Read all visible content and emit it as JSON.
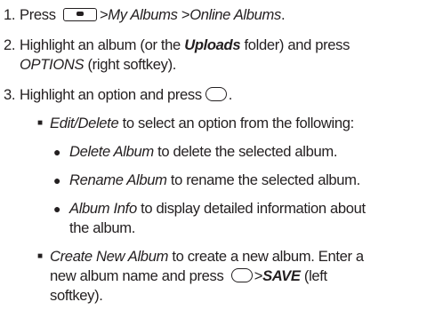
{
  "steps": [
    {
      "number": "1.",
      "text": {
        "press": "Press",
        "sep1": ">",
        "path1": "My Albums",
        "sep2": ">",
        "path2": "Online Albums",
        "end": "."
      }
    },
    {
      "number": "2.",
      "text": {
        "part1": "Highlight an album (or the",
        "uploads": "Uploads",
        "part2": "folder) and press",
        "options": "OPTIONS",
        "part3": "(right softkey)."
      }
    },
    {
      "number": "3.",
      "text": {
        "part1": "Highlight an option and press",
        "end": "."
      }
    }
  ],
  "bullets": {
    "edit_delete": {
      "marker": "■",
      "label": "Edit/Delete",
      "desc": "to select an option from the following:"
    },
    "delete_album": {
      "marker": "●",
      "label": "Delete Album",
      "desc": "to delete the selected album."
    },
    "rename_album": {
      "marker": "●",
      "label": "Rename Album",
      "desc": "to rename the selected album."
    },
    "album_info": {
      "marker": "●",
      "label": "Album Info",
      "desc1": "to display detailed information about",
      "desc2": "the album."
    },
    "create_new_album": {
      "marker": "■",
      "label": "Create New Album",
      "desc1": "to create a new album. Enter a",
      "desc2": "new album name and press",
      "sep": ">",
      "save": "SAVE",
      "desc3": "(left",
      "desc4": "softkey)."
    }
  },
  "icons": {
    "menu_key": "menu-softkey-icon",
    "ok_key": "ok-key-icon"
  }
}
